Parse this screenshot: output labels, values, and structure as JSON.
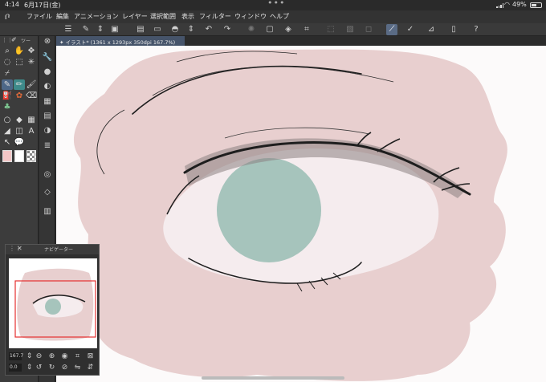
{
  "status_bar": {
    "time": "4:14",
    "date": "6月17日(金)",
    "battery": "49%"
  },
  "menu": [
    "ファイル",
    "編集",
    "アニメーション",
    "レイヤー",
    "選択範囲",
    "表示",
    "フィルター",
    "ウィンドウ",
    "ヘルプ"
  ],
  "tool_panel": {
    "tab_label": "ツー"
  },
  "document": {
    "tab_title": "✦ イラスト* (1361 x 1293px 350dpi 167.7%)"
  },
  "navigator": {
    "title": "ナビゲーター",
    "zoom": "167.7",
    "rotation": "0.0"
  },
  "colors": {
    "skin": "#e8cfcf",
    "iris": "#a6c4bc",
    "sclera": "#f5ecee",
    "ink": "#1e1e1e",
    "ui_dark": "#2b2b2b",
    "accent": "#4d6787"
  }
}
